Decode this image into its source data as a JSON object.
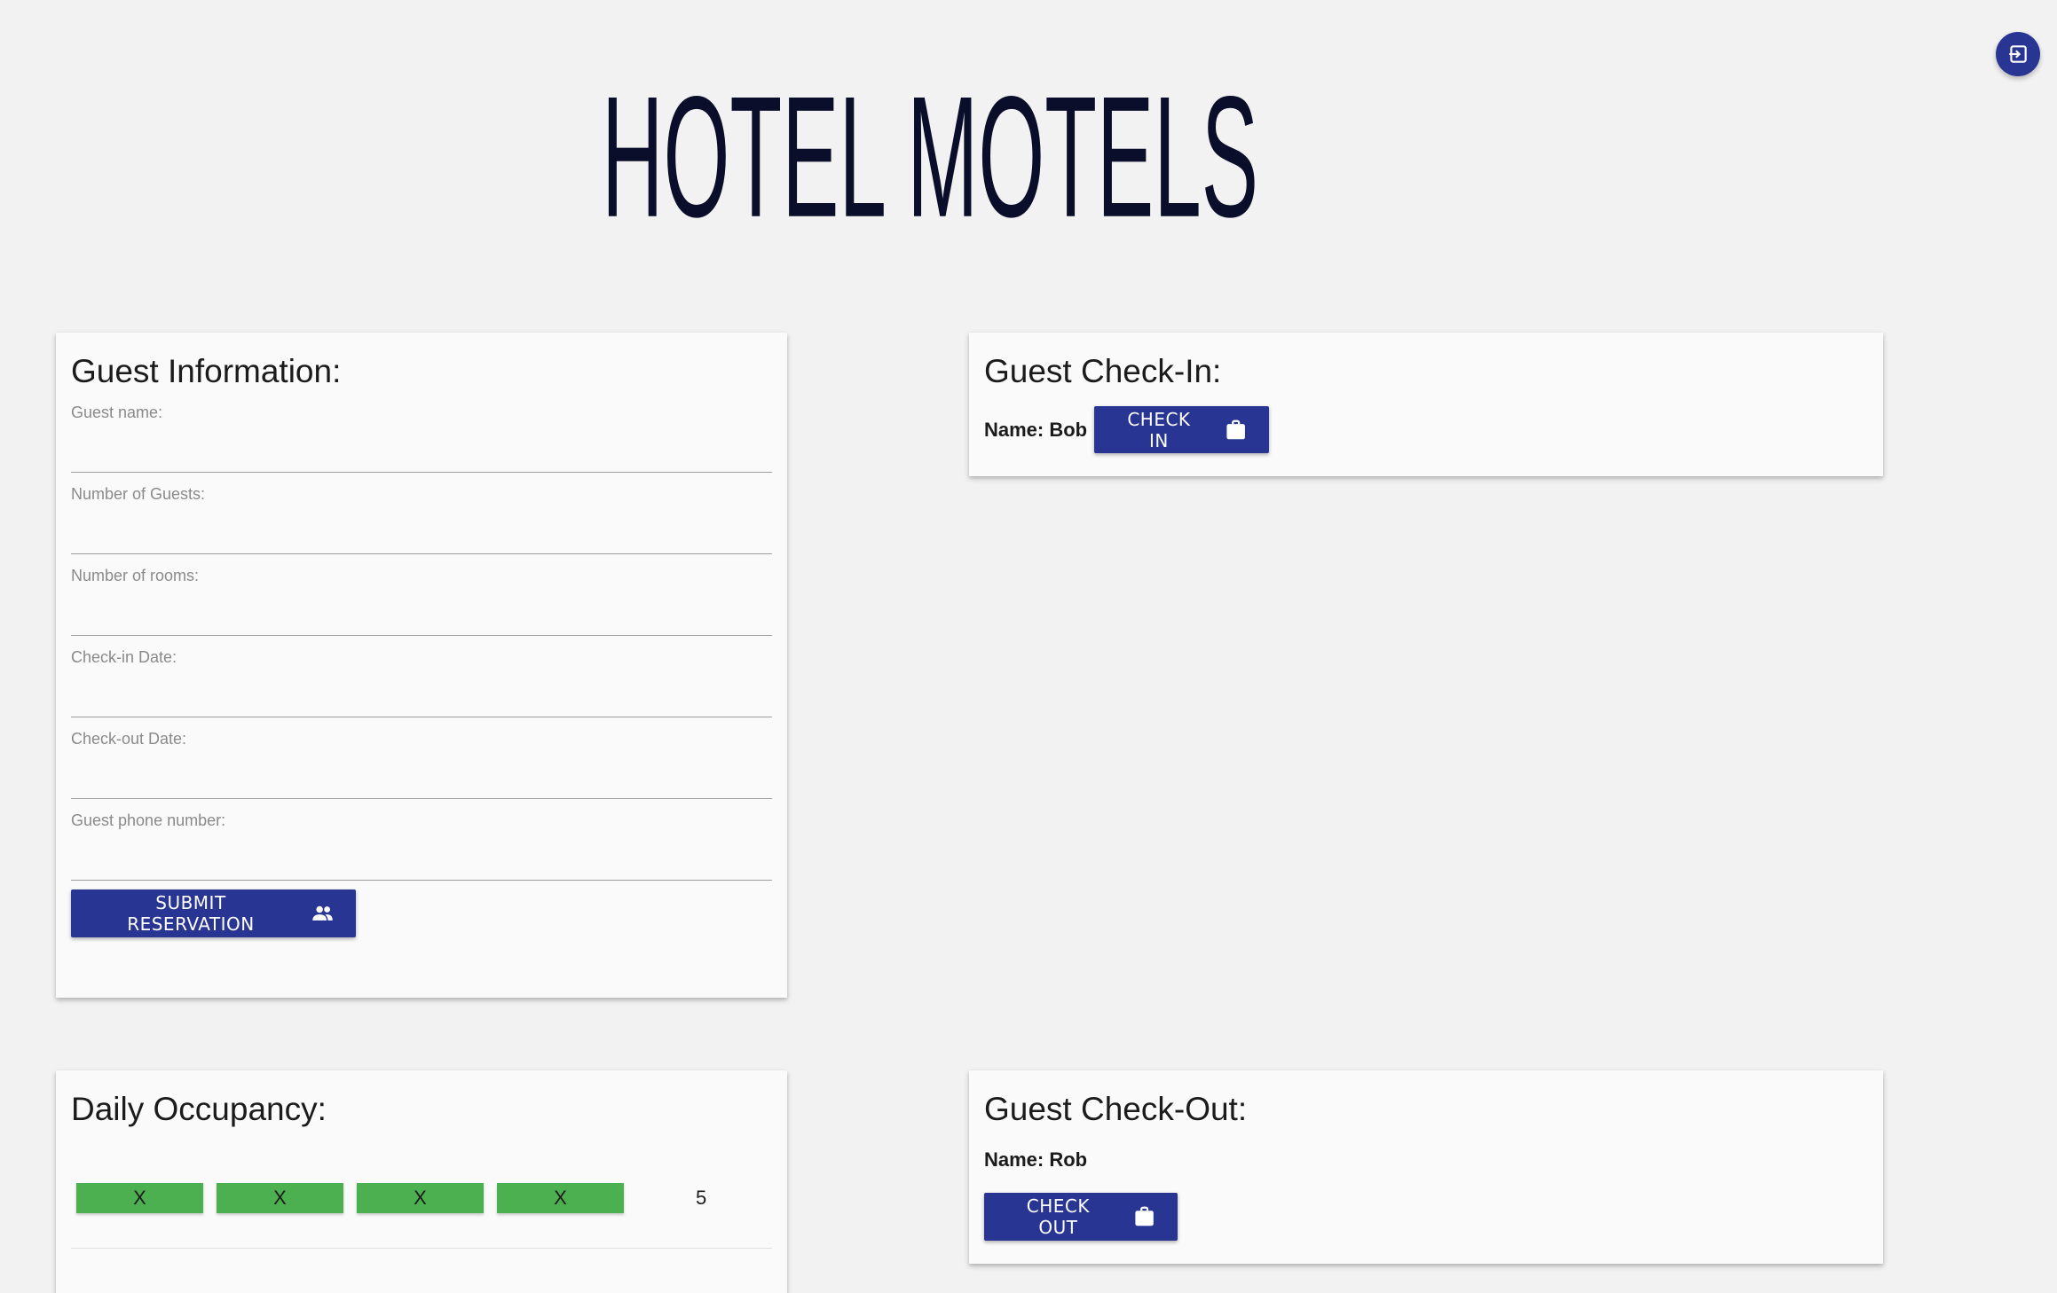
{
  "header": {
    "logo_text": "HOTEL MOTELS",
    "logout_icon": "logout-icon",
    "accent_color": "#283593"
  },
  "guest_info": {
    "title": "Guest Information:",
    "fields": [
      {
        "label": "Guest name:",
        "value": ""
      },
      {
        "label": "Number of Guests:",
        "value": ""
      },
      {
        "label": "Number of rooms:",
        "value": ""
      },
      {
        "label": "Check-in Date:",
        "value": ""
      },
      {
        "label": "Check-out Date:",
        "value": ""
      },
      {
        "label": "Guest phone number:",
        "value": ""
      }
    ],
    "submit_label": "SUBMIT RESERVATION",
    "submit_icon": "people-icon"
  },
  "checkin": {
    "title": "Guest Check-In:",
    "name_text": "Name: Bob",
    "button_label": "CHECK IN",
    "button_icon": "briefcase-icon"
  },
  "occupancy": {
    "title": "Daily Occupancy:",
    "rooms": [
      "X",
      "X",
      "X",
      "X"
    ],
    "room_color": "#4caf50",
    "count": "5"
  },
  "checkout": {
    "title": "Guest Check-Out:",
    "name_text": "Name: Rob",
    "button_label": "CHECK OUT",
    "button_icon": "briefcase-icon"
  }
}
